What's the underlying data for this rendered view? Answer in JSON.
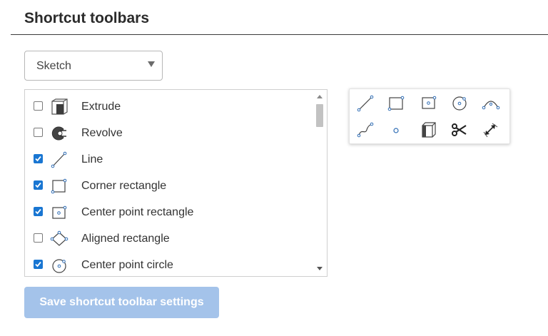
{
  "section": {
    "title": "Shortcut toolbars"
  },
  "toolbar_select": {
    "selected": "Sketch"
  },
  "colors": {
    "accent": "#1976d2",
    "button_disabled": "#a4c3ea",
    "icon_blue": "#2f6db5"
  },
  "shortcut_list": {
    "items": [
      {
        "label": "Extrude",
        "checked": false,
        "icon": "extrude-icon"
      },
      {
        "label": "Revolve",
        "checked": false,
        "icon": "revolve-icon"
      },
      {
        "label": "Line",
        "checked": true,
        "icon": "line-icon"
      },
      {
        "label": "Corner rectangle",
        "checked": true,
        "icon": "corner-rectangle-icon"
      },
      {
        "label": "Center point rectangle",
        "checked": true,
        "icon": "center-point-rectangle-icon"
      },
      {
        "label": "Aligned rectangle",
        "checked": false,
        "icon": "aligned-rectangle-icon"
      },
      {
        "label": "Center point circle",
        "checked": true,
        "icon": "center-point-circle-icon"
      }
    ]
  },
  "preview_toolbar": {
    "tools": [
      "line-icon",
      "corner-rectangle-icon",
      "center-point-rectangle-icon",
      "center-point-circle-icon",
      "three-point-arc-icon",
      "spline-icon",
      "point-icon",
      "use-icon",
      "trim-icon",
      "dimension-icon"
    ]
  },
  "footer": {
    "save_label": "Save shortcut toolbar settings"
  }
}
